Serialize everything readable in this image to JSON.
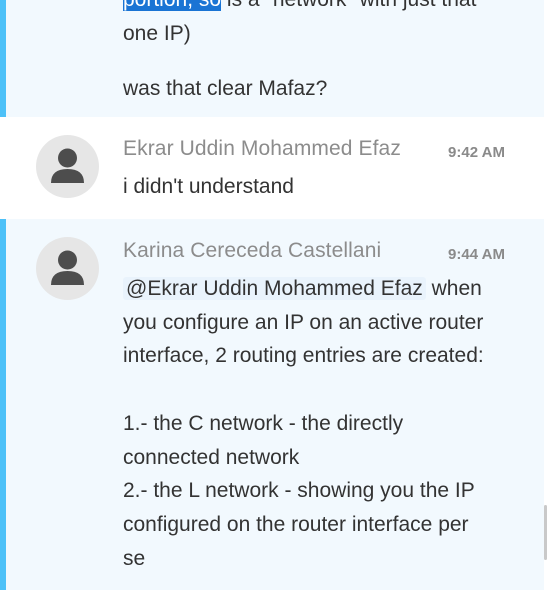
{
  "messages": [
    {
      "id": "m1",
      "highlight": true,
      "lines": {
        "l0_selected": "portion, so",
        "l0_rest": " is a \"network\" with just that",
        "l1": "one IP)",
        "l2": "was that clear Mafaz?"
      }
    },
    {
      "id": "m2",
      "author": "Ekrar Uddin Mohammed Efaz",
      "time": "9:42 AM",
      "text": "i didn't understand",
      "avatar_icon": "user-icon"
    },
    {
      "id": "m3",
      "highlight": true,
      "author": "Karina Cereceda Castellani",
      "time": "9:44 AM",
      "avatar_icon": "user-icon",
      "mention": "@Ekrar Uddin Mohammed Efaz",
      "lines": {
        "l0_rest": " when",
        "l1": "you configure an IP on an active router",
        "l2": "interface, 2 routing entries are created:",
        "l3": "1.- the C network - the directly",
        "l4": "connected network",
        "l5": "2.- the L network - showing you the IP",
        "l6": "configured on the router interface per",
        "l7": "se"
      }
    }
  ],
  "colors": {
    "highlight_bar": "#4dc1f8",
    "highlight_bg": "#f2f9fe",
    "selection": "#1a74d4",
    "mention_bg": "#e9f3fc"
  }
}
